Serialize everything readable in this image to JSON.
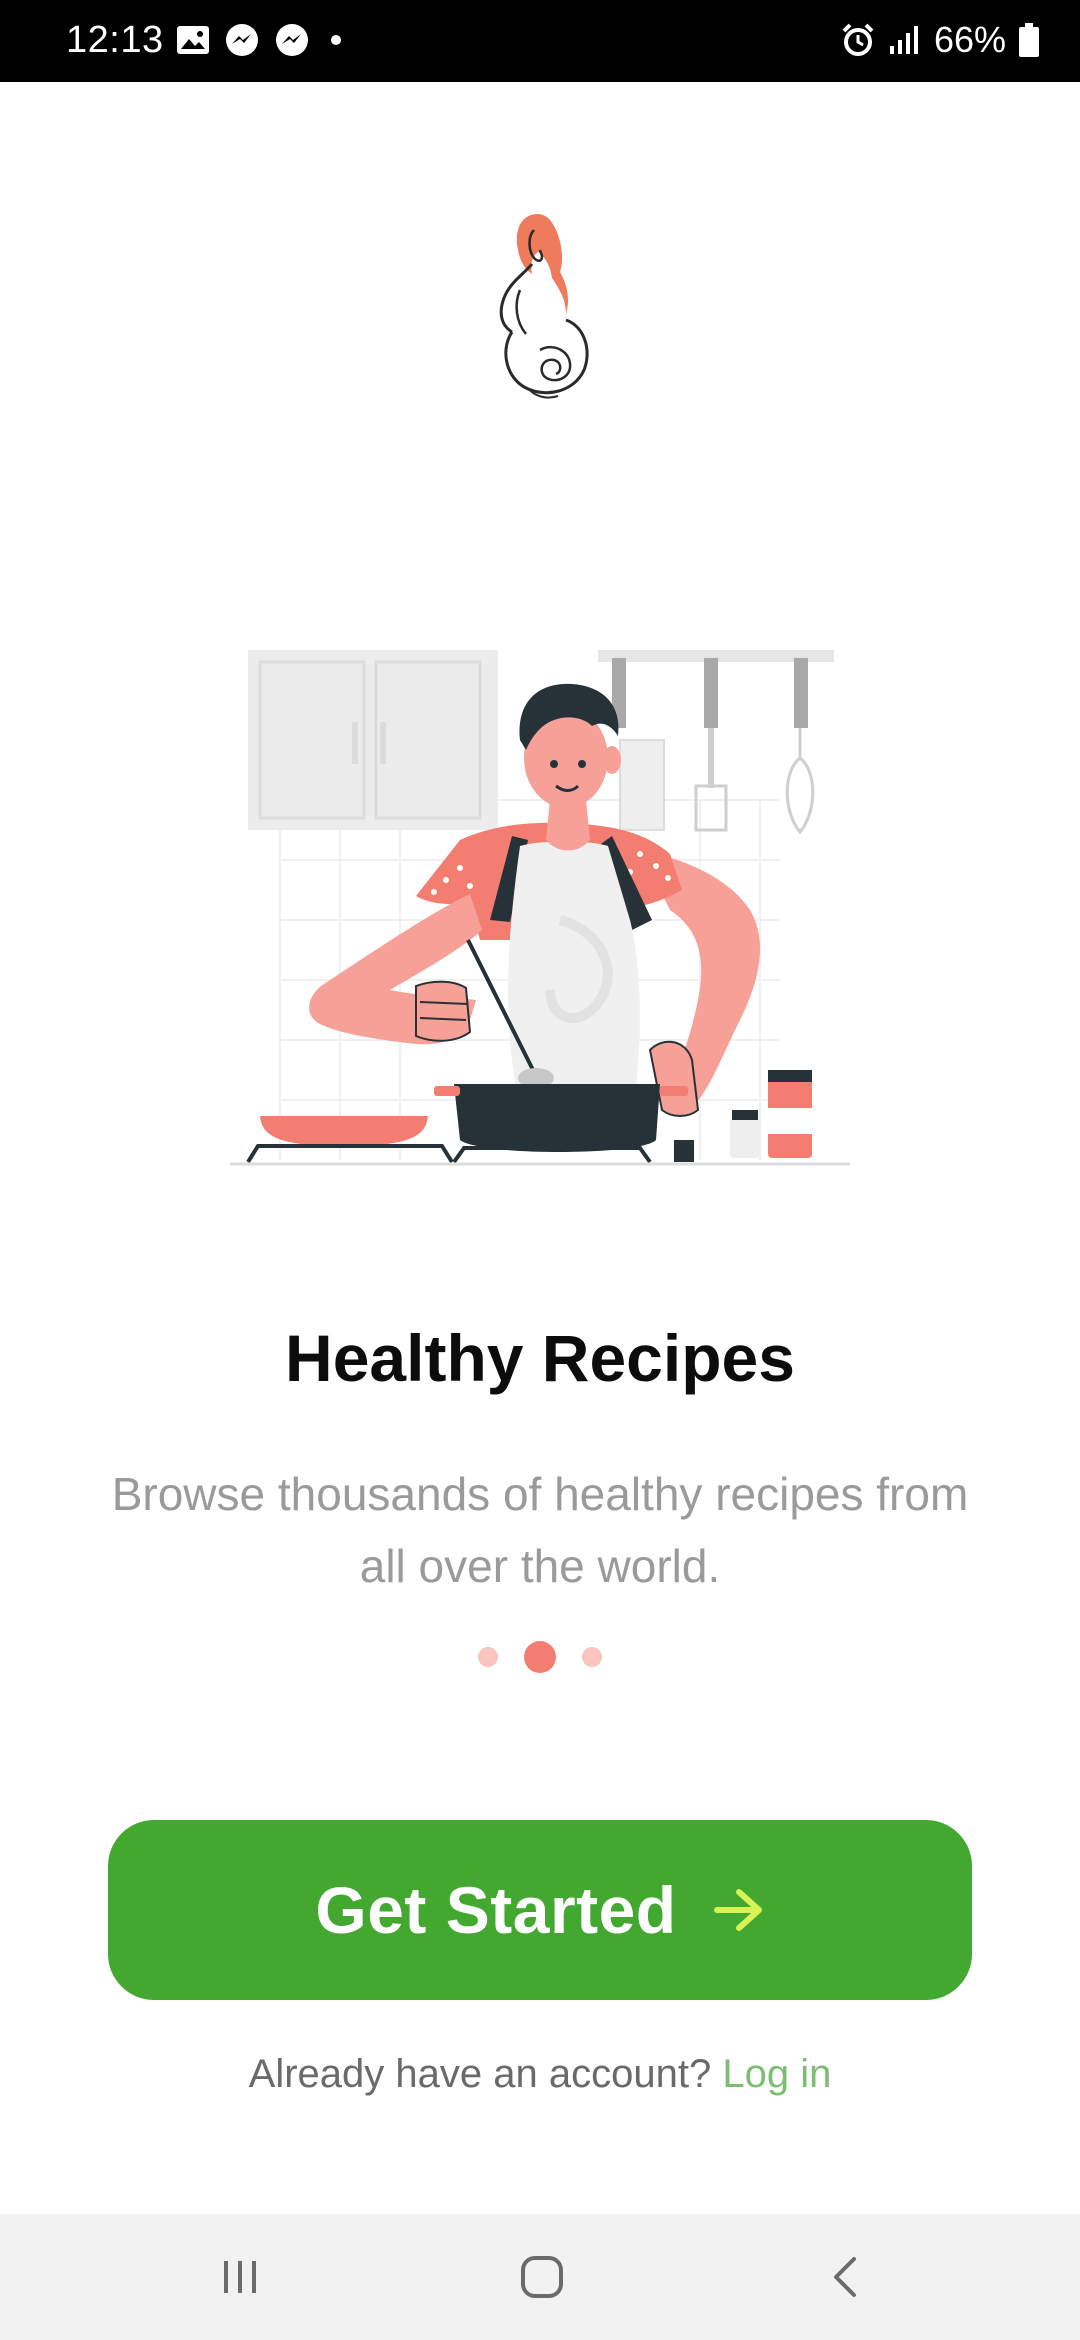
{
  "status_bar": {
    "time": "12:13",
    "battery": "66%",
    "left_icons": [
      "gallery-icon",
      "messenger-icon",
      "messenger-icon",
      "dot-icon"
    ],
    "right_icons": [
      "alarm-icon",
      "signal-icon",
      "battery-icon"
    ]
  },
  "onboarding": {
    "title": "Healthy Recipes",
    "description": "Browse thousands of healthy recipes from all over the world.",
    "page_count": 3,
    "active_page_index": 1
  },
  "actions": {
    "primary_label": "Get Started",
    "primary_icon": "arrow-right-icon",
    "login_prompt": "Already have an account?",
    "login_link": "Log in"
  },
  "navigation": {
    "buttons": [
      "recent-apps-icon",
      "home-icon",
      "back-icon"
    ]
  },
  "colors": {
    "accent_green": "#42a82f",
    "link_green": "#7cbd73",
    "arrow_yellow": "#d9f255",
    "coral": "#f27d70",
    "dot_inactive": "#f9c4bd"
  }
}
